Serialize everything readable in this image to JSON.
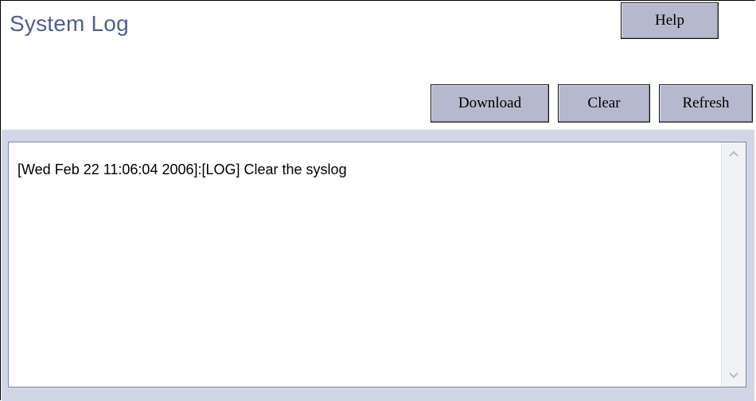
{
  "header": {
    "title": "System Log"
  },
  "toolbar": {
    "help_label": "Help",
    "download_label": "Download",
    "clear_label": "Clear",
    "refresh_label": "Refresh"
  },
  "log": {
    "entries": [
      "[Wed Feb 22 11:06:04 2006]:[LOG] Clear the syslog"
    ]
  },
  "colors": {
    "title": "#4f5f8f",
    "button_bg": "#b6b8cd",
    "panel_bg": "#d1d6e6"
  },
  "icons": {
    "scroll_up": "chevron-up-icon",
    "scroll_down": "chevron-down-icon"
  }
}
